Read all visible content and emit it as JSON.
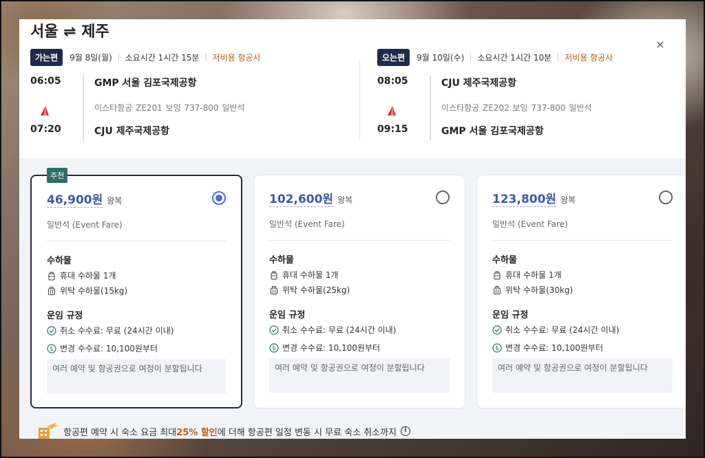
{
  "route": {
    "title": "서울 ⇌ 제주"
  },
  "close_icon": "×",
  "outbound": {
    "badge": "가는편",
    "date": "9월 8일(월)",
    "duration": "소요시간 1시간 15분",
    "carrier_type": "저비용 항공사",
    "dep_time": "06:05",
    "arr_time": "07:20",
    "dep_airport": "GMP 서울 김포국제공항",
    "arr_airport": "CJU 제주국제공항",
    "flight_info": "이스타항공  ZE201  보잉 737-800  일반석"
  },
  "return": {
    "badge": "오는편",
    "date": "9월 10일(수)",
    "duration": "소요시간 1시간 10분",
    "carrier_type": "저비용 항공사",
    "dep_time": "08:05",
    "arr_time": "09:15",
    "dep_airport": "CJU 제주국제공항",
    "arr_airport": "GMP 서울 김포국제공항",
    "flight_info": "이스타항공  ZE202  보잉 737-800  일반석"
  },
  "fares": [
    {
      "badge": "추천",
      "price": "46,900원",
      "trip": "왕복",
      "selected": true,
      "class": "일반석 (Event Fare)",
      "baggage_title": "수하물",
      "carry_on": "휴대 수하물 1개",
      "checked": "위탁 수하물(15kg)",
      "rules_title": "운임 규정",
      "cancel_fee": "취소 수수료: 무료 (24시간 이내)",
      "change_fee": "변경 수수료: 10,100원부터",
      "note": "여러 예약 및 항공권으로 여정이 분할됩니다"
    },
    {
      "price": "102,600원",
      "trip": "왕복",
      "selected": false,
      "class": "일반석 (Event Fare)",
      "baggage_title": "수하물",
      "carry_on": "휴대 수하물 1개",
      "checked": "위탁 수하물(25kg)",
      "rules_title": "운임 규정",
      "cancel_fee": "취소 수수료: 무료 (24시간 이내)",
      "change_fee": "변경 수수료: 10,100원부터",
      "note": "여러 예약 및 항공권으로 여정이 분할됩니다"
    },
    {
      "price": "123,800원",
      "trip": "왕복",
      "selected": false,
      "class": "일반석 (Event Fare)",
      "baggage_title": "수하물",
      "carry_on": "휴대 수하물 1개",
      "checked": "위탁 수하물(30kg)",
      "rules_title": "운임 규정",
      "cancel_fee": "취소 수수료: 무료 (24시간 이내)",
      "change_fee": "변경 수수료: 10,100원부터",
      "note": "여러 예약 및 항공권으로 여정이 분할됩니다"
    }
  ],
  "promo": {
    "pre": "항공편 예약 시 숙소 요금 최대 ",
    "highlight": "25% 할인",
    "post": "에 더해 항공편 일정 변동 시 무료 숙소 취소까지",
    "info_icon": "i"
  },
  "colors": {
    "price": "#3d5a9e",
    "radio_selected": "#4c6ad8",
    "badge_dark": "#1e2b4a",
    "recommend": "#2f6f6a",
    "lowcost": "#b65a1f",
    "airline_red": "#d7262e"
  },
  "icons": {
    "airline_logo": "airline-logo-icon",
    "carry_on": "carry-on-bag-icon",
    "checked": "checked-bag-icon",
    "cancel": "check-circle-icon",
    "change": "dollar-circle-icon",
    "hotel": "hotel-plane-icon"
  }
}
